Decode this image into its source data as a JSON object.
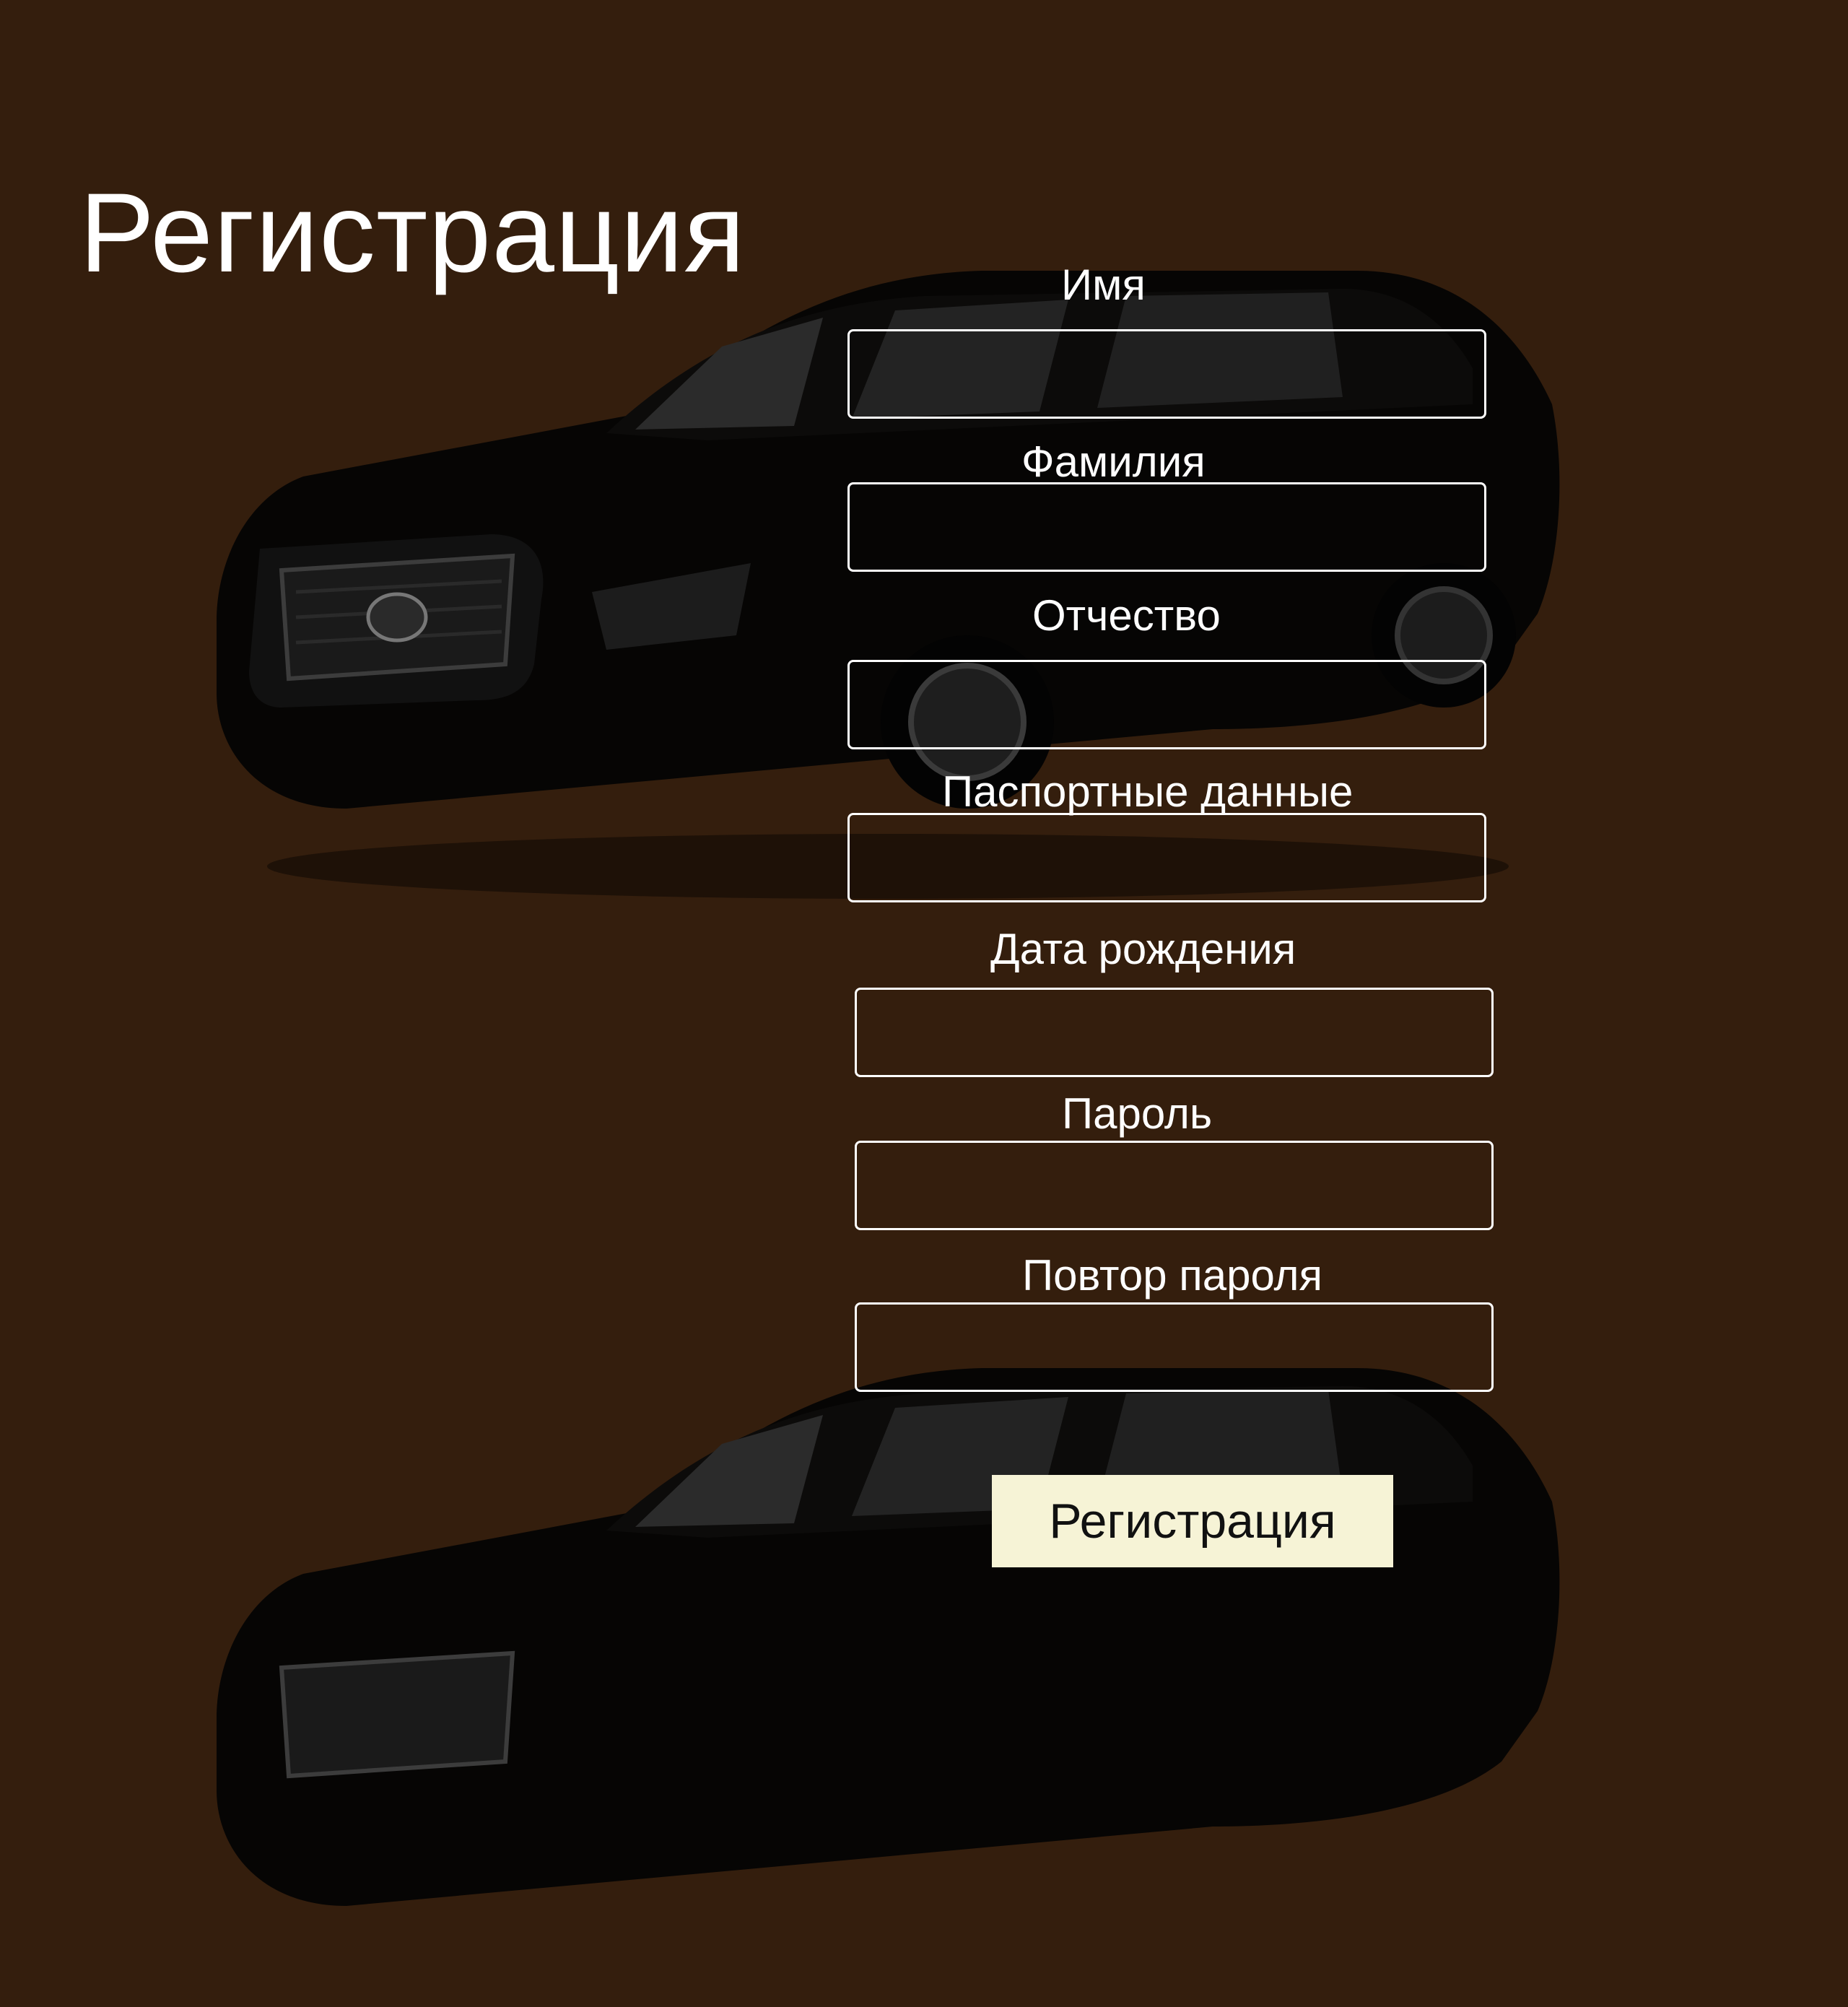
{
  "page": {
    "title": "Регистрация",
    "background_color": "#341e0d",
    "background_image": "car-silhouette"
  },
  "form": {
    "fields": [
      {
        "label": "Имя",
        "value": ""
      },
      {
        "label": "Фамилия",
        "value": ""
      },
      {
        "label": "Отчество",
        "value": ""
      },
      {
        "label": "Паспортные данные",
        "value": ""
      },
      {
        "label": "Дата рождения",
        "value": ""
      },
      {
        "label": "Пароль",
        "value": ""
      },
      {
        "label": "Повтор пароля",
        "value": ""
      }
    ],
    "submit_label": "Регистрация",
    "submit_color": "#f6f3d6"
  }
}
